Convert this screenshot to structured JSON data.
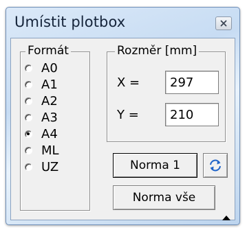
{
  "window": {
    "title": "Umístit plotbox",
    "close_icon": "close-icon"
  },
  "format_group": {
    "legend": "Formát",
    "options": [
      {
        "label": "A0",
        "checked": false
      },
      {
        "label": "A1",
        "checked": false
      },
      {
        "label": "A2",
        "checked": false
      },
      {
        "label": "A3",
        "checked": false
      },
      {
        "label": "A4",
        "checked": true
      },
      {
        "label": "ML",
        "checked": false
      },
      {
        "label": "UZ",
        "checked": false
      }
    ]
  },
  "size_group": {
    "legend": "Rozměr [mm]",
    "x_label": "X =",
    "x_value": "297",
    "y_label": "Y =",
    "y_value": "210"
  },
  "buttons": {
    "norma1": "Norma 1",
    "swap_icon": "swap-arrows-icon",
    "norma_vse": "Norma vše",
    "expand_icon": "triangle-up-icon"
  },
  "colors": {
    "accent_blue": "#1e63c9",
    "window_frame": "#c7dcf3",
    "client_bg": "#f0f0f0"
  }
}
